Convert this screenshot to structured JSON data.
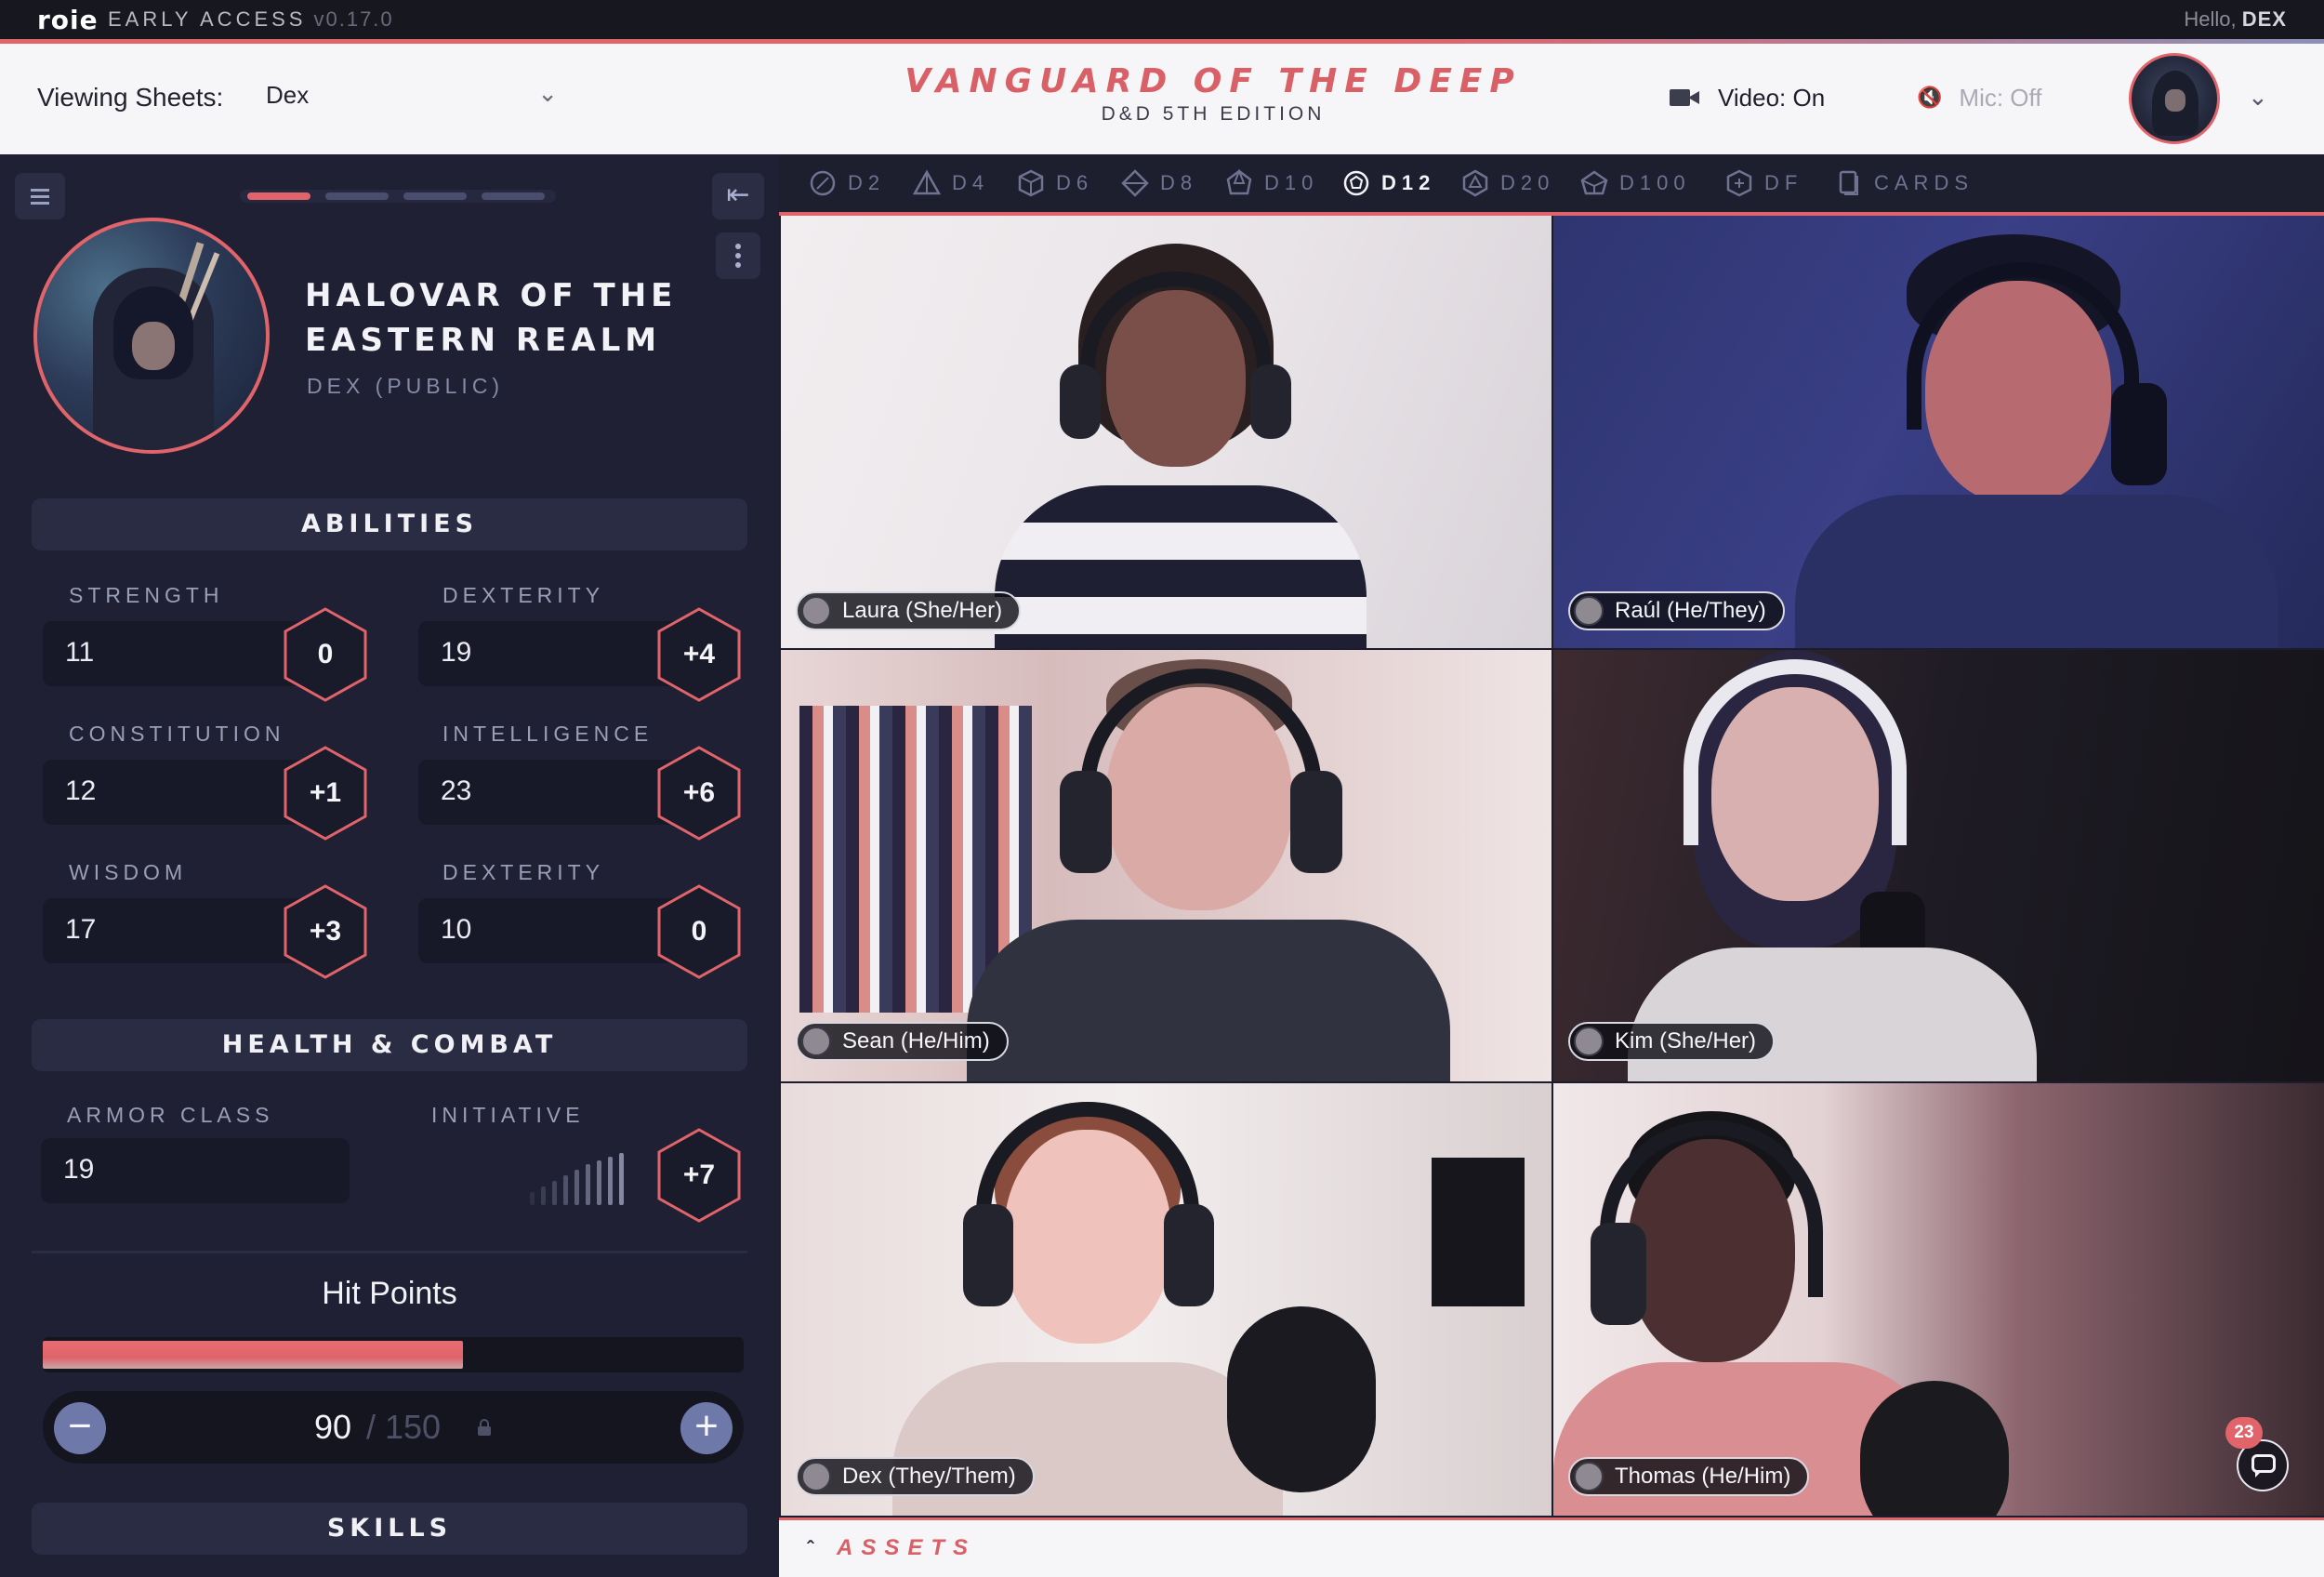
{
  "topbar": {
    "brand": "roie",
    "early_access": "EARLY ACCESS",
    "version": "v0.17.0",
    "hello_prefix": "Hello,",
    "hello_user": "DEX"
  },
  "header": {
    "viewing_label": "Viewing Sheets:",
    "viewing_value": "Dex",
    "campaign_title": "VANGUARD OF THE DEEP",
    "campaign_subtitle": "D&D 5TH EDITION",
    "video_label": "Video: On",
    "mic_label": "Mic: Off"
  },
  "character": {
    "name_line1": "HALOVAR OF THE",
    "name_line2": "EASTERN REALM",
    "owner": "DEX (PUBLIC)"
  },
  "abilities": {
    "heading": "ABILITIES",
    "items": [
      {
        "label": "STRENGTH",
        "score": "11",
        "mod": "0"
      },
      {
        "label": "DEXTERITY",
        "score": "19",
        "mod": "+4"
      },
      {
        "label": "CONSTITUTION",
        "score": "12",
        "mod": "+1"
      },
      {
        "label": "INTELLIGENCE",
        "score": "23",
        "mod": "+6"
      },
      {
        "label": "WISDOM",
        "score": "17",
        "mod": "+3"
      },
      {
        "label": "DEXTERITY",
        "score": "10",
        "mod": "0"
      }
    ]
  },
  "combat": {
    "heading": "HEALTH & COMBAT",
    "armor_class_label": "ARMOR CLASS",
    "armor_class": "19",
    "initiative_label": "INITIATIVE",
    "initiative": "+7"
  },
  "hit_points": {
    "title": "Hit Points",
    "current": "90",
    "max_display": "/ 150",
    "fill_fraction": 0.6
  },
  "skills_heading": "SKILLS",
  "dice": [
    {
      "label": "D2"
    },
    {
      "label": "D4"
    },
    {
      "label": "D6"
    },
    {
      "label": "D8"
    },
    {
      "label": "D10"
    },
    {
      "label": "D12",
      "active": true
    },
    {
      "label": "D20"
    },
    {
      "label": "D100"
    },
    {
      "label": "DF"
    },
    {
      "label": "CARDS"
    }
  ],
  "participants": [
    {
      "name": "Laura (She/Her)"
    },
    {
      "name": "Raúl (He/They)"
    },
    {
      "name": "Sean (He/Him)"
    },
    {
      "name": "Kim (She/Her)"
    },
    {
      "name": "Dex (They/Them)"
    },
    {
      "name": "Thomas (He/Him)"
    }
  ],
  "chat": {
    "unread": "23"
  },
  "assets": {
    "label": "ASSETS"
  },
  "colors": {
    "accent": "#e0646a",
    "panel": "#1f2033",
    "header_bg": "#f6f6f8"
  }
}
